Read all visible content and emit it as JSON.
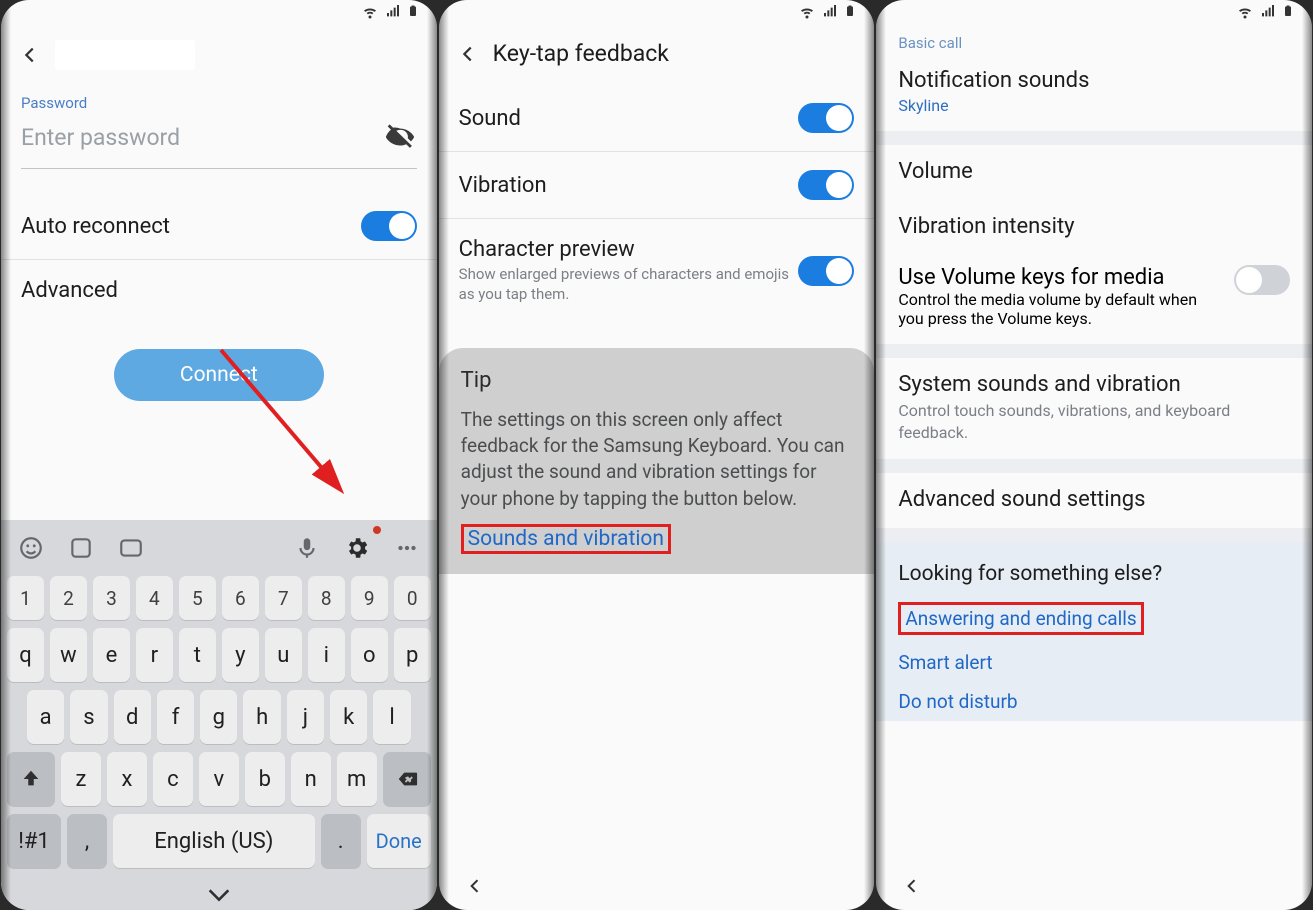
{
  "panel1": {
    "header_title": "",
    "password_label": "Password",
    "password_placeholder": "Enter password",
    "auto_reconnect": "Auto reconnect",
    "advanced": "Advanced",
    "connect": "Connect",
    "keyboard": {
      "row_num": [
        "1",
        "2",
        "3",
        "4",
        "5",
        "6",
        "7",
        "8",
        "9",
        "0"
      ],
      "row1": [
        "q",
        "w",
        "e",
        "r",
        "t",
        "y",
        "u",
        "i",
        "o",
        "p"
      ],
      "row2": [
        "a",
        "s",
        "d",
        "f",
        "g",
        "h",
        "j",
        "k",
        "l"
      ],
      "row3": [
        "z",
        "x",
        "c",
        "v",
        "b",
        "n",
        "m"
      ],
      "sym": "!#1",
      "lang": "English (US)",
      "dot": ".",
      "done": "Done"
    }
  },
  "panel2": {
    "title": "Key-tap feedback",
    "sound": "Sound",
    "vibration": "Vibration",
    "char_preview": "Character preview",
    "char_preview_sub": "Show enlarged previews of characters and emojis as you tap them.",
    "tip_title": "Tip",
    "tip_body": "The settings on this screen only affect feedback for the Samsung Keyboard. You can adjust the sound and vibration settings for your phone by tapping the button below.",
    "tip_link": "Sounds and vibration"
  },
  "panel3": {
    "section": "Basic call",
    "notif_sounds": "Notification sounds",
    "notif_sounds_val": "Skyline",
    "volume": "Volume",
    "vib_intensity": "Vibration intensity",
    "vol_keys": "Use Volume keys for media",
    "vol_keys_sub": "Control the media volume by default when you press the Volume keys.",
    "sys_sounds": "System sounds and vibration",
    "sys_sounds_sub": "Control touch sounds, vibrations, and keyboard feedback.",
    "adv": "Advanced sound settings",
    "looking": "Looking for something else?",
    "link1": "Answering and ending calls",
    "link2": "Smart alert",
    "link3": "Do not disturb"
  }
}
